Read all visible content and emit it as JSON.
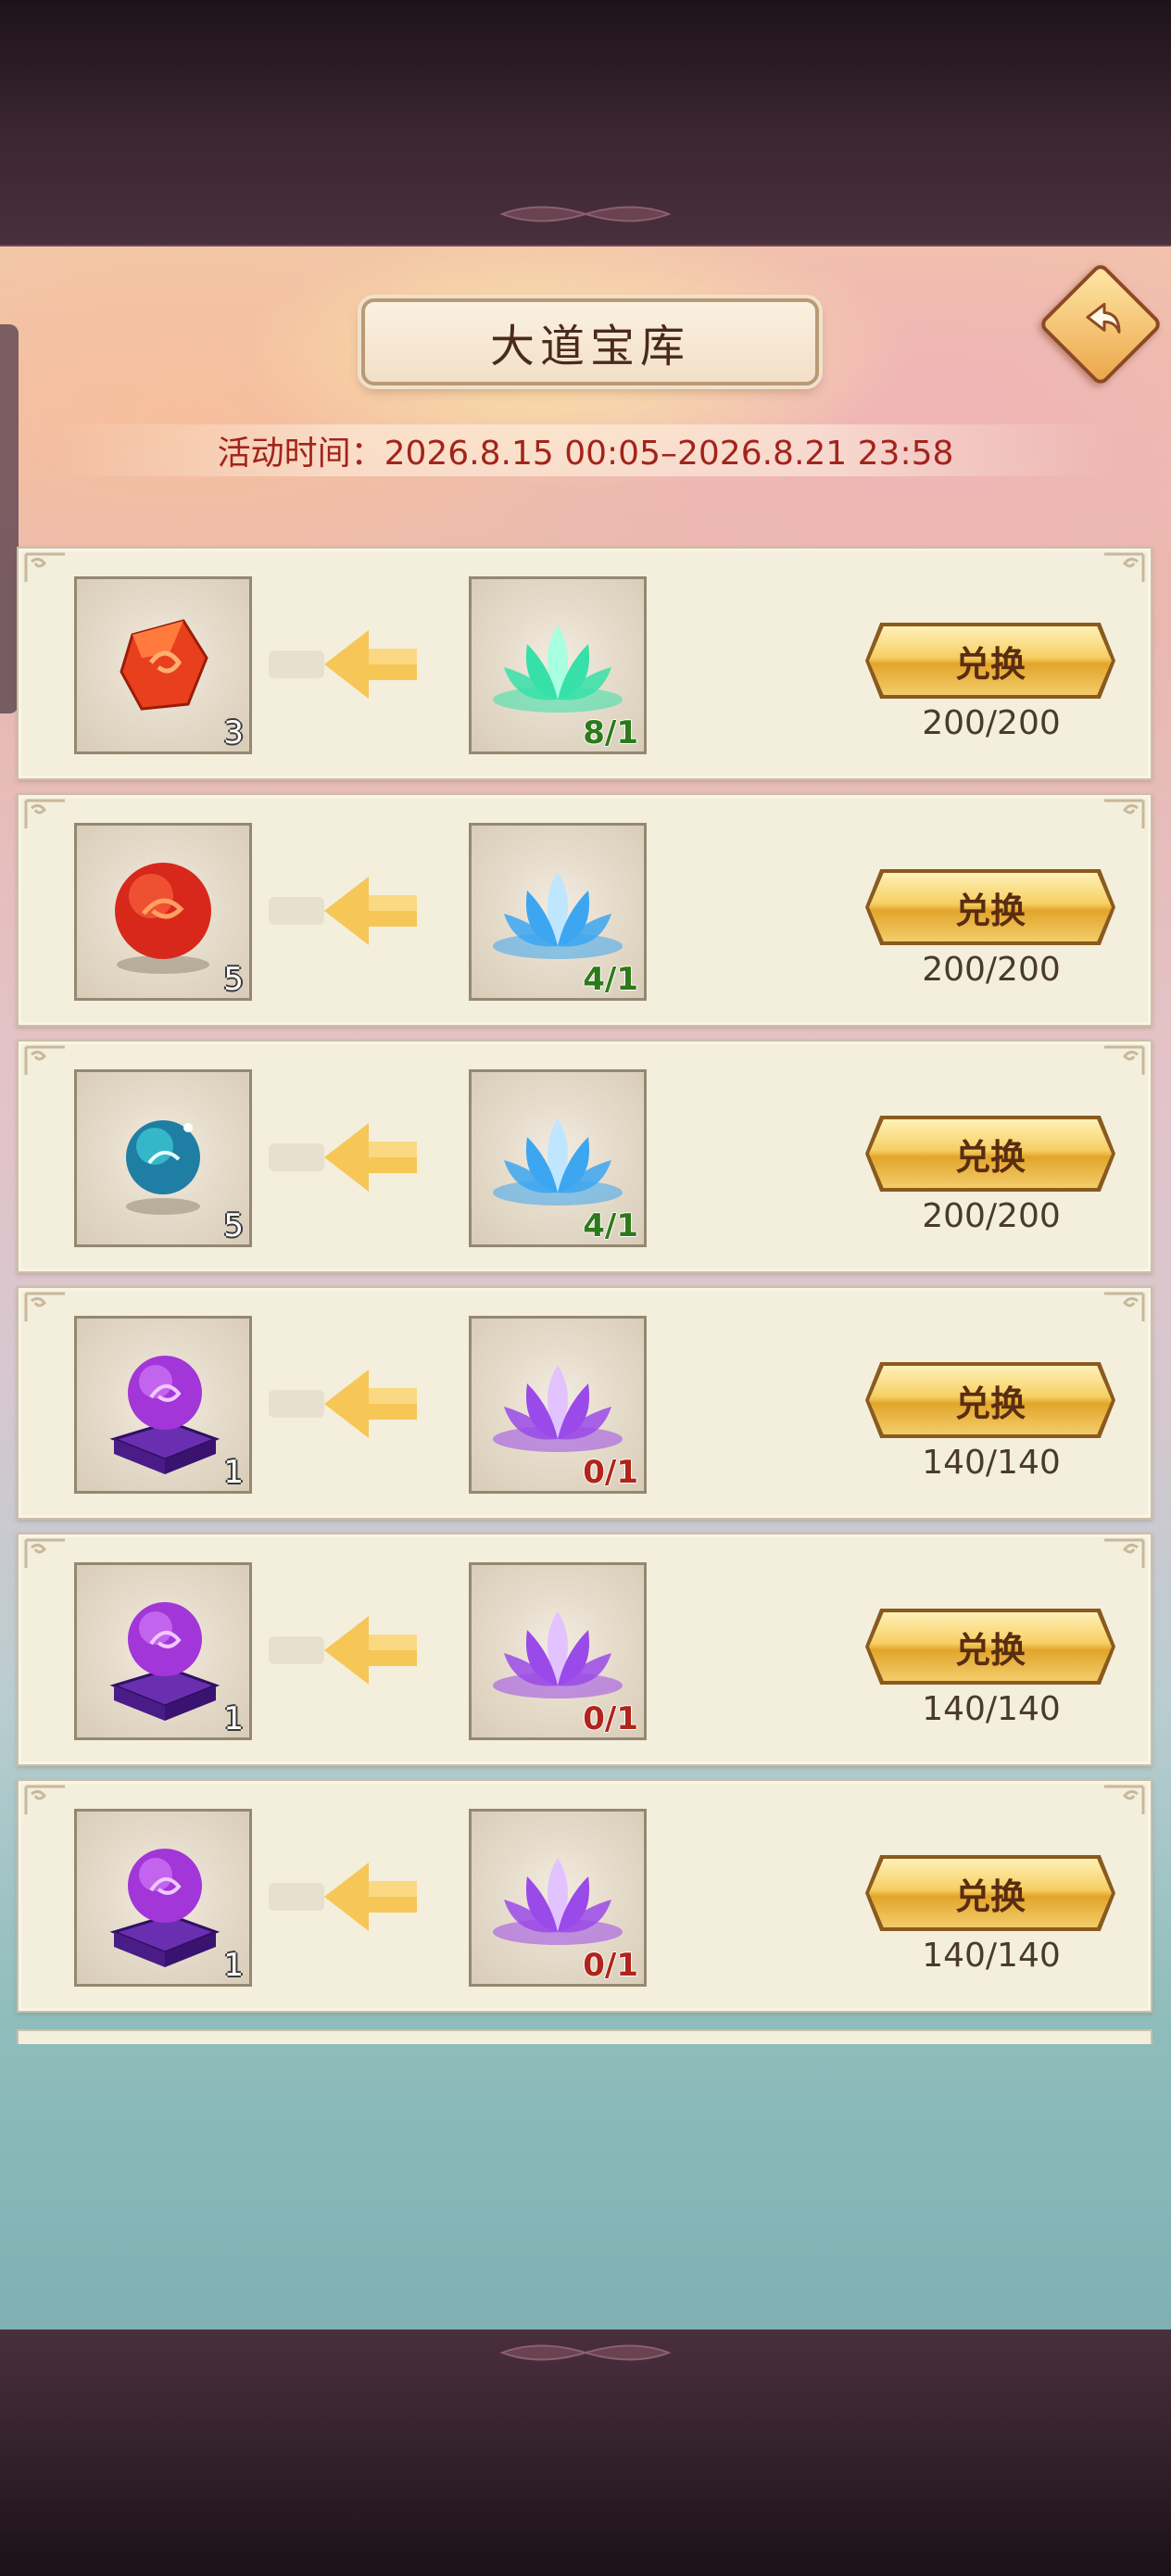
{
  "header": {
    "title": "大道宝库",
    "activity_time": "活动时间：2026.8.15 00:05–2026.8.21 23:58"
  },
  "rows": [
    {
      "reward_icon": "red-crystal-icon",
      "reward_count": "3",
      "cost_icon": "green-lotus-icon",
      "cost_progress": "8/1",
      "cost_met": true,
      "button_label": "兑换",
      "limit": "200/200"
    },
    {
      "reward_icon": "red-orb-icon",
      "reward_count": "5",
      "cost_icon": "blue-lotus-icon",
      "cost_progress": "4/1",
      "cost_met": true,
      "button_label": "兑换",
      "limit": "200/200"
    },
    {
      "reward_icon": "blue-orb-icon",
      "reward_count": "5",
      "cost_icon": "blue-lotus-icon",
      "cost_progress": "4/1",
      "cost_met": true,
      "button_label": "兑换",
      "limit": "200/200"
    },
    {
      "reward_icon": "purple-orb-pedestal-icon",
      "reward_count": "1",
      "cost_icon": "purple-lotus-icon",
      "cost_progress": "0/1",
      "cost_met": false,
      "button_label": "兑换",
      "limit": "140/140"
    },
    {
      "reward_icon": "purple-orb-pedestal-icon",
      "reward_count": "1",
      "cost_icon": "purple-lotus-icon",
      "cost_progress": "0/1",
      "cost_met": false,
      "button_label": "兑换",
      "limit": "140/140"
    },
    {
      "reward_icon": "purple-orb-pedestal-icon",
      "reward_count": "1",
      "cost_icon": "purple-lotus-icon",
      "cost_progress": "0/1",
      "cost_met": false,
      "button_label": "兑换",
      "limit": "140/140"
    }
  ],
  "colors": {
    "requirement_met": "#2d7a1a",
    "requirement_unmet": "#b1241a",
    "time_text": "#a2241b"
  }
}
